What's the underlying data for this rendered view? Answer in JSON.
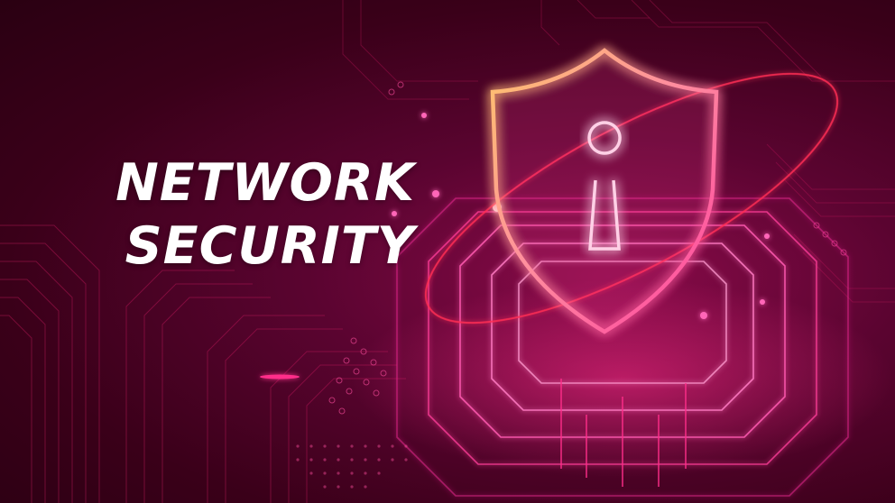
{
  "headline": {
    "line1": "NETWORK",
    "line2": "SECURITY"
  },
  "colors": {
    "background": "#3a0019",
    "accent_pink": "#ff2e8a",
    "glow_orange": "#ffb15a",
    "text": "#ffffff"
  },
  "icons": {
    "shield": "shield-lock-icon",
    "keyhole": "keyhole-icon"
  }
}
